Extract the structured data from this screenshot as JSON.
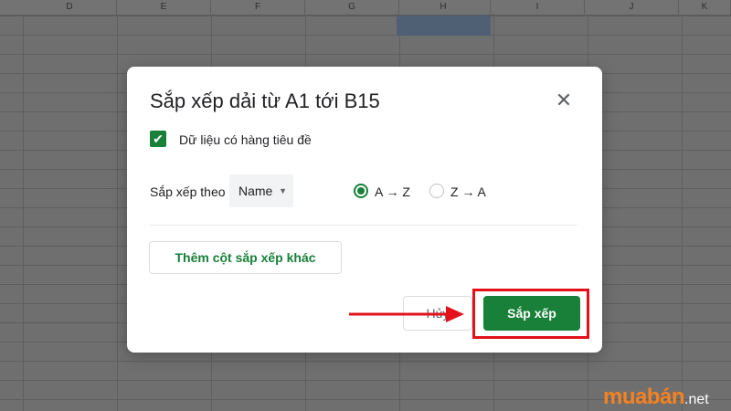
{
  "sheet": {
    "columns": [
      "D",
      "E",
      "F",
      "G",
      "H",
      "I",
      "J",
      "K"
    ]
  },
  "dialog": {
    "title": "Sắp xếp dải từ A1 tới B15",
    "close_icon": "close-icon",
    "header_row_checkbox": {
      "checked": true,
      "label": "Dữ liệu có hàng tiêu đề"
    },
    "sort_by": {
      "label": "Sắp xếp theo",
      "selected_column": "Name",
      "options": [
        {
          "label": "A → Z",
          "selected": true
        },
        {
          "label": "Z → A",
          "selected": false
        }
      ]
    },
    "add_sort_column_label": "Thêm cột sắp xếp khác",
    "cancel_label": "Hủy",
    "sort_label": "Sắp xếp"
  },
  "annotation": {
    "color": "#e3121a",
    "arrow_icon": "right-arrow-icon"
  },
  "watermark": {
    "brand": "muabán",
    "tld": ".net"
  },
  "colors": {
    "accent": "#188038",
    "highlight": "#e3121a",
    "brand": "#f58220"
  }
}
